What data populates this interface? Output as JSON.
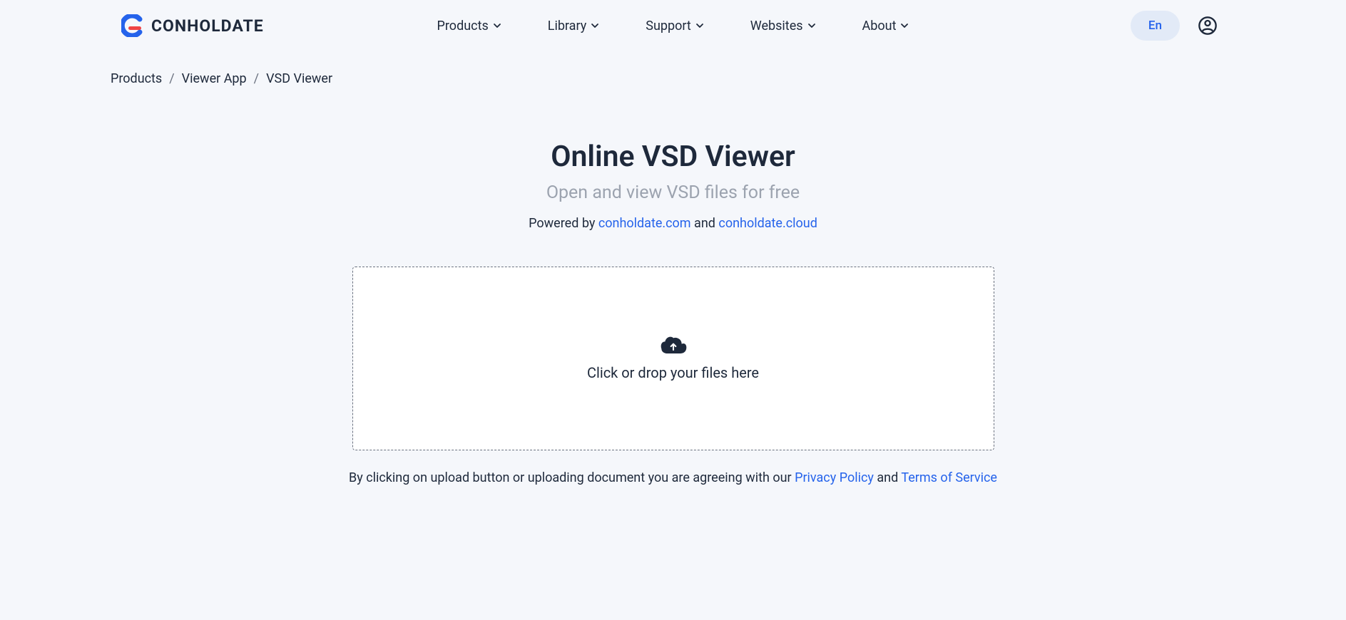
{
  "logo": {
    "text": "CONHOLDATE"
  },
  "nav": {
    "items": [
      {
        "label": "Products"
      },
      {
        "label": "Library"
      },
      {
        "label": "Support"
      },
      {
        "label": "Websites"
      },
      {
        "label": "About"
      }
    ]
  },
  "lang": {
    "label": "En"
  },
  "breadcrumb": {
    "items": [
      {
        "label": "Products"
      },
      {
        "label": "Viewer App"
      },
      {
        "label": "VSD Viewer"
      }
    ],
    "separator": "/"
  },
  "main": {
    "title": "Online VSD Viewer",
    "subtitle": "Open and view VSD files for free",
    "powered_prefix": "Powered by ",
    "powered_link1": "conholdate.com",
    "powered_and": " and ",
    "powered_link2": "conholdate.cloud"
  },
  "dropzone": {
    "text": "Click or drop your files here"
  },
  "terms": {
    "prefix": "By clicking on upload button or uploading document you are agreeing with our ",
    "privacy": "Privacy Policy",
    "and": " and ",
    "tos": "Terms of Service"
  }
}
